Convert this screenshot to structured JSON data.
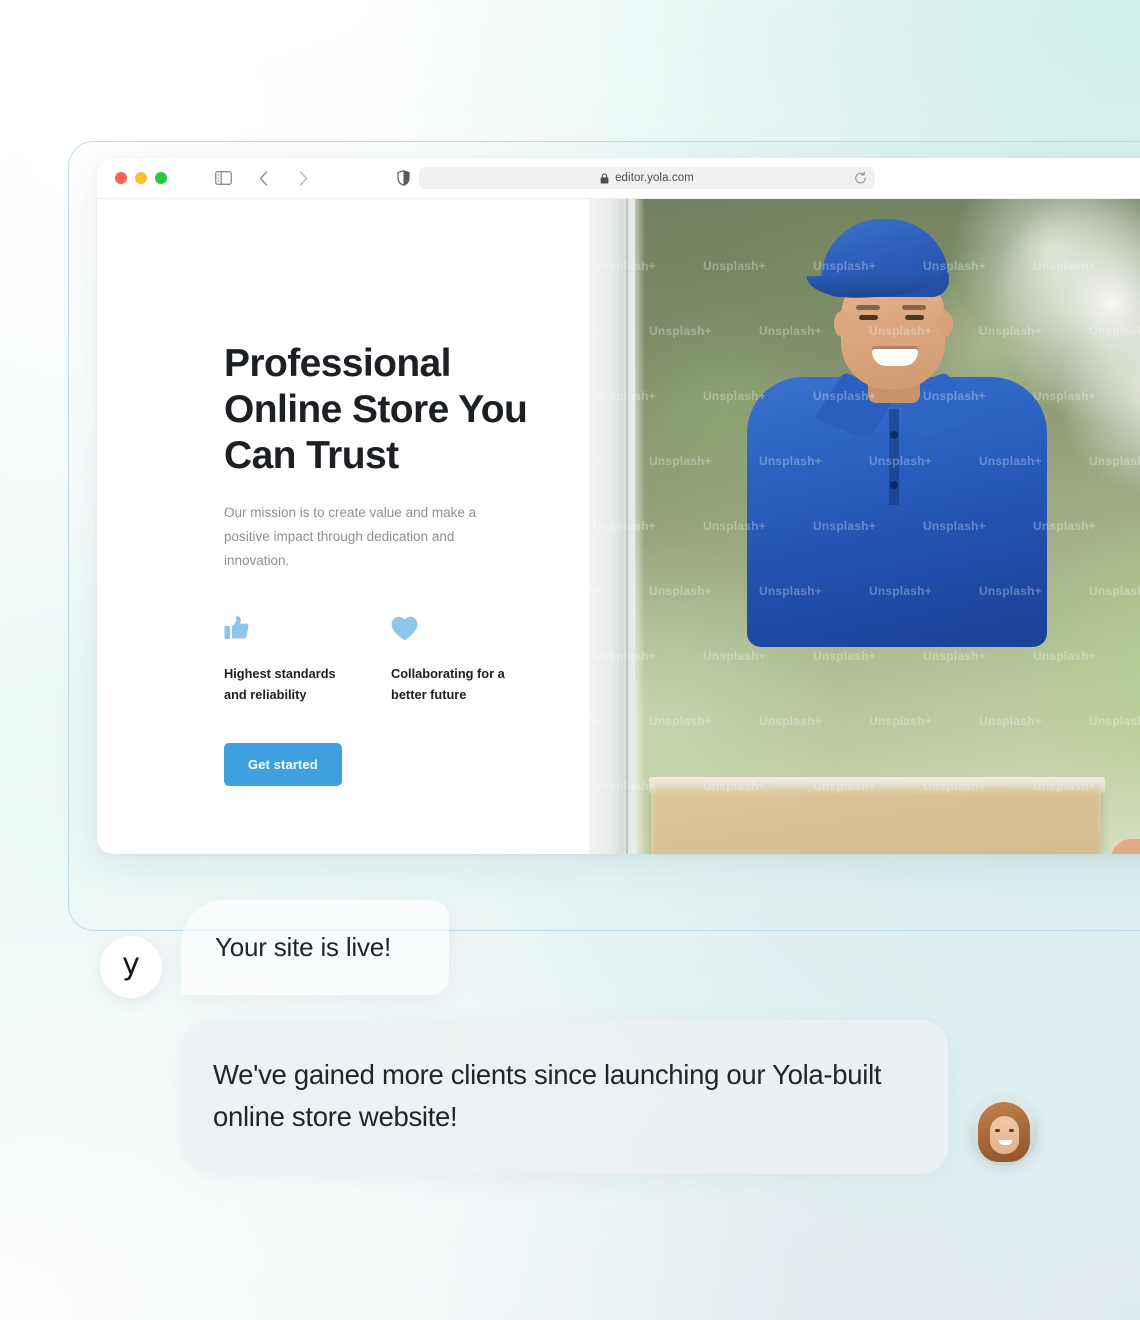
{
  "browser": {
    "url": "editor.yola.com",
    "lock_icon": "lock-icon",
    "reload_icon": "reload-icon",
    "sidebar_icon": "sidebar-toggle-icon",
    "back_icon": "chevron-left-icon",
    "forward_icon": "chevron-right-icon",
    "shield_icon": "privacy-shield-icon",
    "traffic_lights": [
      "close-red",
      "minimize-yellow",
      "zoom-green"
    ]
  },
  "site": {
    "headline": "Professional Online Store You Can Trust",
    "subtext": "Our mission is to create value and make a positive impact through dedication and innovation.",
    "features": [
      {
        "icon": "thumbs-up-icon",
        "label": "Highest standards and reliability"
      },
      {
        "icon": "heart-icon",
        "label": "Collaborating for a better future"
      }
    ],
    "cta_label": "Get started",
    "hero_image_alt": "Smiling delivery man in blue uniform and cap holding a cardboard box",
    "hero_watermark": "Unsplash+"
  },
  "chat": {
    "messages": [
      {
        "avatar": "yola-logo-avatar",
        "avatar_glyph": "y",
        "text": "Your site is live!"
      },
      {
        "avatar": "customer-photo-avatar",
        "text": "We've gained more clients since launching our Yola-built online store website!"
      }
    ]
  },
  "colors": {
    "accent_blue": "#3EA0DE",
    "feature_icon_blue": "#8DC6EA",
    "frame_border": "#BCDCEC",
    "heading_dark": "#1C2024",
    "body_grey": "#8B9097"
  }
}
